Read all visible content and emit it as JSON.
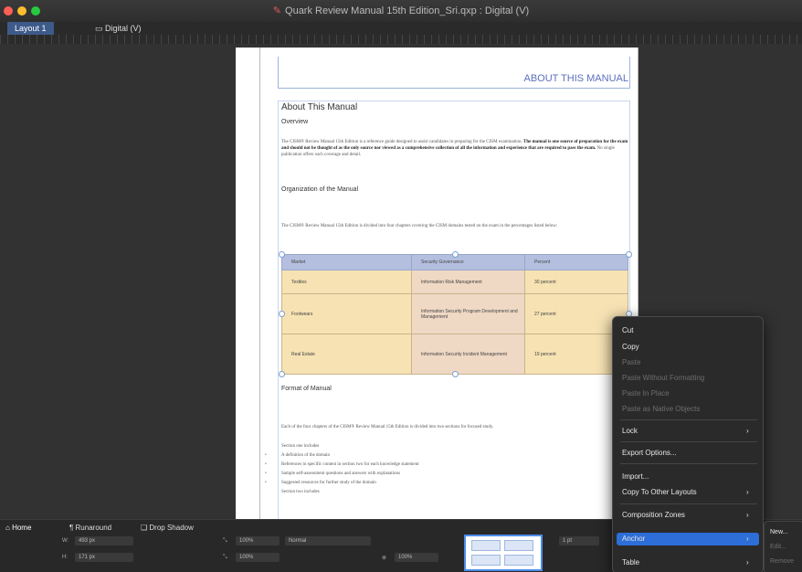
{
  "window": {
    "title": "Quark Review Manual 15th Edition_Sri.qxp : Digital (V)"
  },
  "tabs": [
    {
      "label": "Layout 1"
    },
    {
      "label": "Digital (V)"
    }
  ],
  "document": {
    "running_header": "ABOUT THIS MANUAL",
    "heading": "About This Manual",
    "sections": {
      "overview": "Overview",
      "organization": "Organization of the Manual",
      "format": "Format of Manual"
    },
    "overview_text_plain": "The CISM® Review Manual 15th Edition is a reference guide designed to assist candidates in preparing for the CISM examination.",
    "overview_text_bold": "The manual is one source of preparation for the exam and should not be thought of as the only source nor viewed as a comprehensive collection of all the information and experience that are required to pass the exam.",
    "overview_text_end": "No single publication offers such coverage and detail.",
    "organization_text": "The CISM® Review Manual 15th Edition is divided into four chapters covering the CISM domains tested on the exam in the percentages listed below:",
    "format_text": "Each of the four chapters of the CISM® Review Manual 15th Edition is divided into two sections for focused study.",
    "section_one_intro": "Section one includes",
    "bullets": [
      "A definition of the domain",
      "References to specific content in section two for each knowledge statement",
      "Sample self-assessment questions and answers with explanations",
      "Suggested resources for further study of the domain"
    ],
    "section_two_intro": "Section two includes",
    "table": {
      "headers": [
        "Market",
        "Security Governance",
        "Percent"
      ],
      "rows": [
        [
          "Textiles",
          "Information Risk Management",
          "30 percent"
        ],
        [
          "Footwears",
          "Information Security Program Development and Management",
          "27 percent"
        ],
        [
          "Real Estate",
          "Information Security Incident Management",
          "19 percent"
        ]
      ]
    }
  },
  "bottom_panel": {
    "tabs": [
      {
        "label": "Home"
      },
      {
        "label": "Runaround"
      },
      {
        "label": "Drop Shadow"
      }
    ],
    "w_label": "W:",
    "w_value": "493 px",
    "h_label": "H:",
    "h_value": "171 px",
    "scale_x": "100%",
    "scale_y": "100%",
    "blend": "Normal",
    "zoom": "100%",
    "stroke": "1 pt"
  },
  "context_menu": {
    "items": [
      {
        "label": "Cut",
        "enabled": true
      },
      {
        "label": "Copy",
        "enabled": true
      },
      {
        "label": "Paste",
        "enabled": false
      },
      {
        "label": "Paste Without Formatting",
        "enabled": false
      },
      {
        "label": "Paste In Place",
        "enabled": false
      },
      {
        "label": "Paste as Native Objects",
        "enabled": false
      },
      {
        "label": "Lock",
        "enabled": true,
        "submenu": true
      },
      {
        "label": "Export Options...",
        "enabled": true
      },
      {
        "label": "Import...",
        "enabled": true
      },
      {
        "label": "Copy To Other Layouts",
        "enabled": true,
        "submenu": true
      },
      {
        "label": "Composition Zones",
        "enabled": true,
        "submenu": true
      },
      {
        "label": "Anchor",
        "enabled": true,
        "submenu": true,
        "highlighted": true
      },
      {
        "label": "Table",
        "enabled": true,
        "submenu": true
      }
    ],
    "submenu_items": [
      {
        "label": "New...",
        "enabled": true
      },
      {
        "label": "Edit...",
        "enabled": false
      },
      {
        "label": "Remove",
        "enabled": false
      }
    ]
  },
  "colors": {
    "accent": "#2d6ed8",
    "header_text": "#5b6fbf",
    "table_header": "#b4bfdf",
    "table_cell": "#f6e2b3"
  }
}
